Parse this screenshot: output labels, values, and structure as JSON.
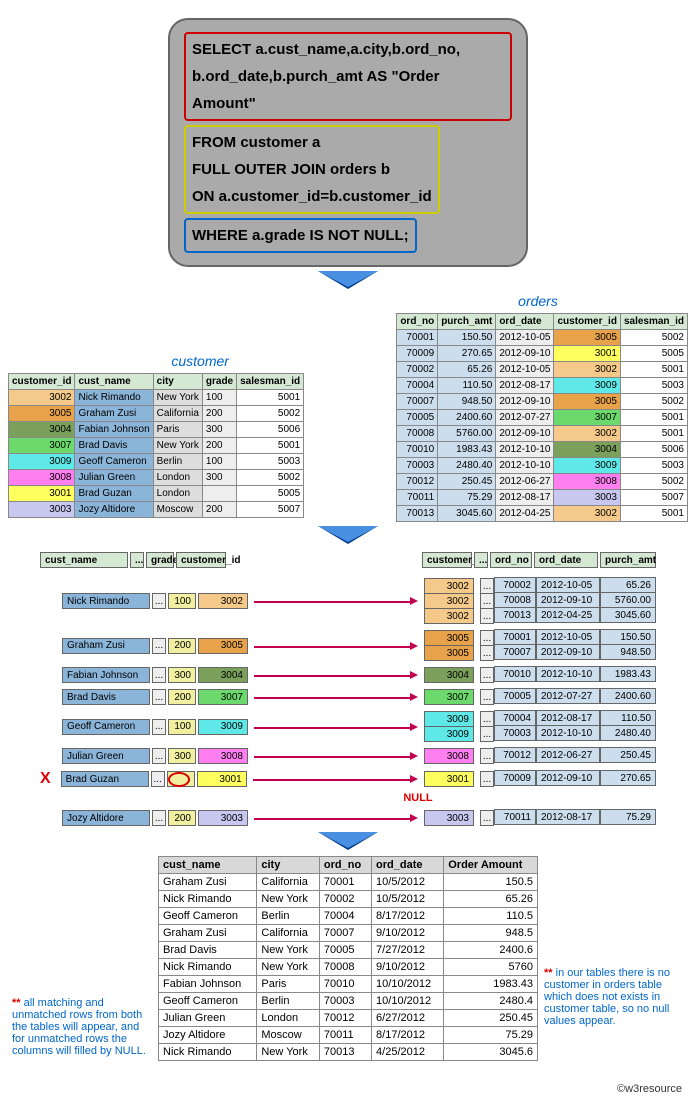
{
  "sql": {
    "select1": "SELECT  a.cust_name,a.city,b.ord_no,",
    "select2": "b.ord_date,b.purch_amt AS \"Order Amount\"",
    "from1": "FROM   customer a",
    "from2": "FULL OUTER JOIN orders b",
    "from3": "ON a.customer_id=b.customer_id",
    "where": "WHERE a.grade IS NOT NULL;"
  },
  "labels": {
    "customer": "customer",
    "orders": "orders"
  },
  "customer": {
    "headers": [
      "customer_id",
      "cust_name",
      "city",
      "grade",
      "salesman_id"
    ],
    "rows": [
      {
        "cid": "3002",
        "name": "Nick Rimando",
        "city": "New York",
        "grade": "100",
        "sid": "5001",
        "cls": "c-3002"
      },
      {
        "cid": "3005",
        "name": "Graham Zusi",
        "city": "California",
        "grade": "200",
        "sid": "5002",
        "cls": "c-3005"
      },
      {
        "cid": "3004",
        "name": "Fabian Johnson",
        "city": "Paris",
        "grade": "300",
        "sid": "5006",
        "cls": "c-3004"
      },
      {
        "cid": "3007",
        "name": "Brad Davis",
        "city": "New York",
        "grade": "200",
        "sid": "5001",
        "cls": "c-3007"
      },
      {
        "cid": "3009",
        "name": "Geoff Cameron",
        "city": "Berlin",
        "grade": "100",
        "sid": "5003",
        "cls": "c-3009"
      },
      {
        "cid": "3008",
        "name": "Julian Green",
        "city": "London",
        "grade": "300",
        "sid": "5002",
        "cls": "c-3008"
      },
      {
        "cid": "3001",
        "name": "Brad Guzan",
        "city": "London",
        "grade": "",
        "sid": "5005",
        "cls": "c-3001"
      },
      {
        "cid": "3003",
        "name": "Jozy Altidore",
        "city": "Moscow",
        "grade": "200",
        "sid": "5007",
        "cls": "c-3003"
      }
    ]
  },
  "orders": {
    "headers": [
      "ord_no",
      "purch_amt",
      "ord_date",
      "customer_id",
      "salesman_id"
    ],
    "rows": [
      {
        "ord_no": "70001",
        "amt": "150.50",
        "date": "2012-10-05",
        "cid": "3005",
        "sid": "5002",
        "cls": "c-3005"
      },
      {
        "ord_no": "70009",
        "amt": "270.65",
        "date": "2012-09-10",
        "cid": "3001",
        "sid": "5005",
        "cls": "c-3001"
      },
      {
        "ord_no": "70002",
        "amt": "65.26",
        "date": "2012-10-05",
        "cid": "3002",
        "sid": "5001",
        "cls": "c-3002"
      },
      {
        "ord_no": "70004",
        "amt": "110.50",
        "date": "2012-08-17",
        "cid": "3009",
        "sid": "5003",
        "cls": "c-3009"
      },
      {
        "ord_no": "70007",
        "amt": "948.50",
        "date": "2012-09-10",
        "cid": "3005",
        "sid": "5002",
        "cls": "c-3005"
      },
      {
        "ord_no": "70005",
        "amt": "2400.60",
        "date": "2012-07-27",
        "cid": "3007",
        "sid": "5001",
        "cls": "c-3007"
      },
      {
        "ord_no": "70008",
        "amt": "5760.00",
        "date": "2012-09-10",
        "cid": "3002",
        "sid": "5001",
        "cls": "c-3002"
      },
      {
        "ord_no": "70010",
        "amt": "1983.43",
        "date": "2012-10-10",
        "cid": "3004",
        "sid": "5006",
        "cls": "c-3004"
      },
      {
        "ord_no": "70003",
        "amt": "2480.40",
        "date": "2012-10-10",
        "cid": "3009",
        "sid": "5003",
        "cls": "c-3009"
      },
      {
        "ord_no": "70012",
        "amt": "250.45",
        "date": "2012-06-27",
        "cid": "3008",
        "sid": "5002",
        "cls": "c-3008"
      },
      {
        "ord_no": "70011",
        "amt": "75.29",
        "date": "2012-08-17",
        "cid": "3003",
        "sid": "5007",
        "cls": "c-3003"
      },
      {
        "ord_no": "70013",
        "amt": "3045.60",
        "date": "2012-04-25",
        "cid": "3002",
        "sid": "5001",
        "cls": "c-3002"
      }
    ]
  },
  "join_headers_left": [
    "cust_name",
    "...",
    "grade",
    "customer_id"
  ],
  "join_headers_right": [
    "customer_id",
    "...",
    "ord_no",
    "ord_date",
    "purch_amt"
  ],
  "join_rows": [
    {
      "name": "Nick Rimando",
      "grade": "100",
      "cid": "3002",
      "cls": "c-3002",
      "right": [
        {
          "cid": "3002",
          "ord": "70002",
          "date": "2012-10-05",
          "amt": "65.26"
        },
        {
          "cid": "3002",
          "ord": "70008",
          "date": "2012-09-10",
          "amt": "5760.00"
        },
        {
          "cid": "3002",
          "ord": "70013",
          "date": "2012-04-25",
          "amt": "3045.60"
        }
      ]
    },
    {
      "name": "Graham Zusi",
      "grade": "200",
      "cid": "3005",
      "cls": "c-3005",
      "right": [
        {
          "cid": "3005",
          "ord": "70001",
          "date": "2012-10-05",
          "amt": "150.50"
        },
        {
          "cid": "3005",
          "ord": "70007",
          "date": "2012-09-10",
          "amt": "948.50"
        }
      ]
    },
    {
      "name": "Fabian Johnson",
      "grade": "300",
      "cid": "3004",
      "cls": "c-3004",
      "right": [
        {
          "cid": "3004",
          "ord": "70010",
          "date": "2012-10-10",
          "amt": "1983.43"
        }
      ]
    },
    {
      "name": "Brad Davis",
      "grade": "200",
      "cid": "3007",
      "cls": "c-3007",
      "right": [
        {
          "cid": "3007",
          "ord": "70005",
          "date": "2012-07-27",
          "amt": "2400.60"
        }
      ]
    },
    {
      "name": "Geoff Cameron",
      "grade": "100",
      "cid": "3009",
      "cls": "c-3009",
      "right": [
        {
          "cid": "3009",
          "ord": "70004",
          "date": "2012-08-17",
          "amt": "110.50"
        },
        {
          "cid": "3009",
          "ord": "70003",
          "date": "2012-10-10",
          "amt": "2480.40"
        }
      ]
    },
    {
      "name": "Julian Green",
      "grade": "300",
      "cid": "3008",
      "cls": "c-3008",
      "right": [
        {
          "cid": "3008",
          "ord": "70012",
          "date": "2012-06-27",
          "amt": "250.45"
        }
      ]
    },
    {
      "name": "Brad Guzan",
      "grade": "",
      "cid": "3001",
      "cls": "c-3001",
      "null": true,
      "right": [
        {
          "cid": "3001",
          "ord": "70009",
          "date": "2012-09-10",
          "amt": "270.65"
        }
      ]
    },
    {
      "name": "Jozy Altidore",
      "grade": "200",
      "cid": "3003",
      "cls": "c-3003",
      "right": [
        {
          "cid": "3003",
          "ord": "70011",
          "date": "2012-08-17",
          "amt": "75.29"
        }
      ]
    }
  ],
  "null_text": "NULL",
  "final": {
    "headers": [
      "cust_name",
      "city",
      "ord_no",
      "ord_date",
      "Order Amount"
    ],
    "rows": [
      [
        "Graham Zusi",
        "California",
        "70001",
        "10/5/2012",
        "150.5"
      ],
      [
        "Nick Rimando",
        "New York",
        "70002",
        "10/5/2012",
        "65.26"
      ],
      [
        "Geoff Cameron",
        "Berlin",
        "70004",
        "8/17/2012",
        "110.5"
      ],
      [
        "Graham Zusi",
        "California",
        "70007",
        "9/10/2012",
        "948.5"
      ],
      [
        "Brad Davis",
        "New York",
        "70005",
        "7/27/2012",
        "2400.6"
      ],
      [
        "Nick Rimando",
        "New York",
        "70008",
        "9/10/2012",
        "5760"
      ],
      [
        "Fabian Johnson",
        "Paris",
        "70010",
        "10/10/2012",
        "1983.43"
      ],
      [
        "Geoff Cameron",
        "Berlin",
        "70003",
        "10/10/2012",
        "2480.4"
      ],
      [
        "Julian Green",
        "London",
        "70012",
        "6/27/2012",
        "250.45"
      ],
      [
        "Jozy Altidore",
        "Moscow",
        "70011",
        "8/17/2012",
        "75.29"
      ],
      [
        "Nick Rimando",
        "New York",
        "70013",
        "4/25/2012",
        "3045.6"
      ]
    ]
  },
  "notes": {
    "left_stars": "**",
    "left": " all matching and unmatched rows from both the tables will appear, and for unmatched rows the columns will filled by NULL.",
    "right_stars": "**",
    "right": " in our tables there is no customer in orders table which does not exists in customer table, so no null values appear."
  },
  "footer": "©w3resource"
}
